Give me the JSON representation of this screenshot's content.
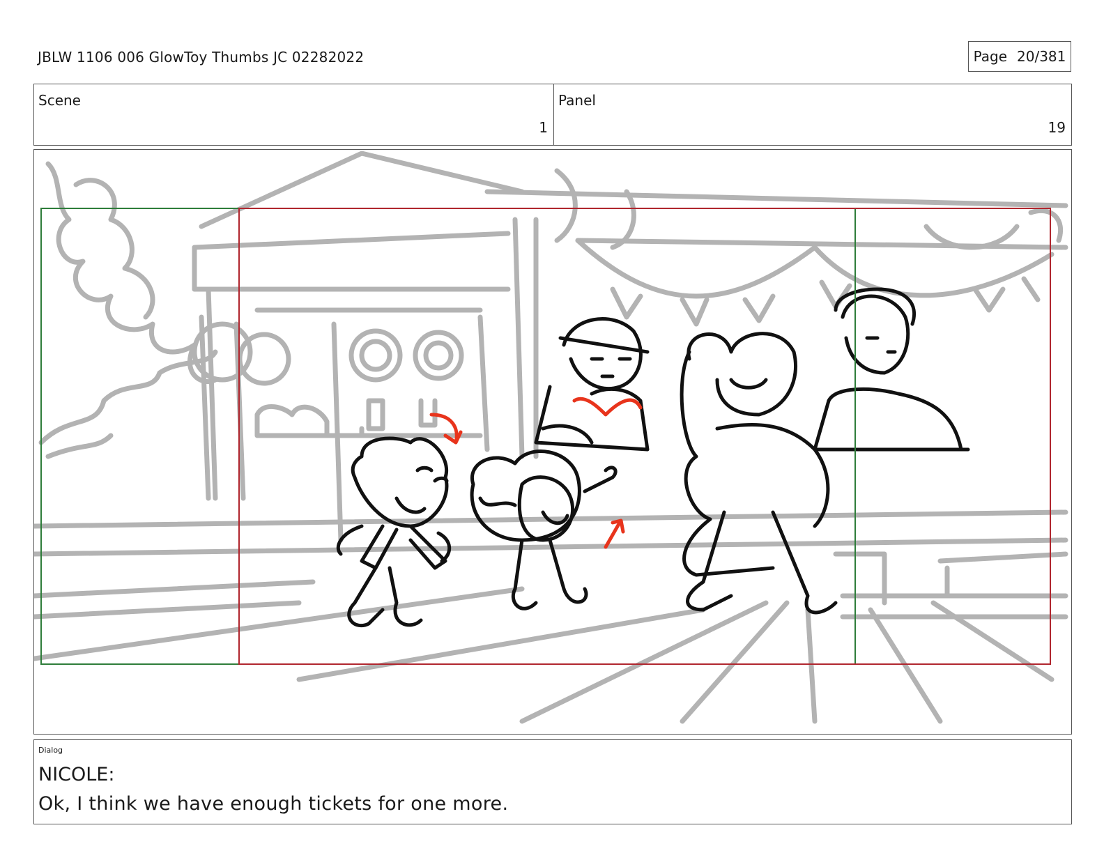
{
  "document": {
    "title": "JBLW 1106 006 GlowToy Thumbs JC 02282022",
    "page_label": "Page",
    "page_number": "20/381"
  },
  "header": {
    "scene_label": "Scene",
    "scene_value": "1",
    "panel_label": "Panel",
    "panel_value": "19"
  },
  "dialog": {
    "label": "Dialog",
    "speaker": "NICOLE:",
    "text": "Ok, I think we have enough tickets for one more."
  },
  "colors": {
    "background_sketch": "#b3b3b3",
    "character_ink": "#111111",
    "note_red": "#e8341c",
    "frame_green": "#2e7d3a",
    "frame_red": "#b0262e"
  }
}
